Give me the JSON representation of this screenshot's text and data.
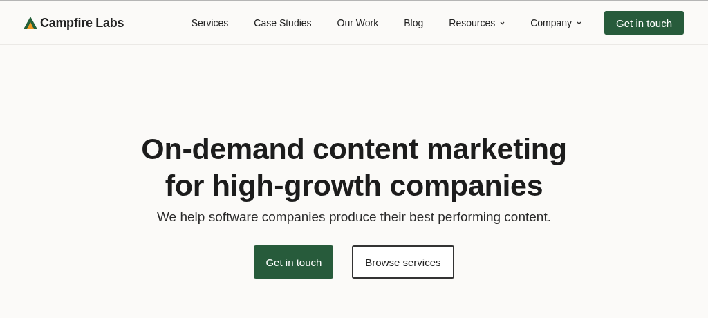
{
  "header": {
    "logo": "Campfire Labs",
    "nav": [
      {
        "label": "Services",
        "kind": "link"
      },
      {
        "label": "Case Studies",
        "kind": "link"
      },
      {
        "label": "Our Work",
        "kind": "link"
      },
      {
        "label": "Blog",
        "kind": "link"
      },
      {
        "label": "Resources",
        "kind": "dropdown"
      },
      {
        "label": "Company",
        "kind": "dropdown"
      }
    ],
    "cta": "Get in touch"
  },
  "hero": {
    "title_lines": [
      "On-demand content marketing",
      "for high-growth companies"
    ],
    "subtitle": "We help software companies produce their best performing content.",
    "buttons": [
      {
        "label": "Get in touch",
        "kind": "primary"
      },
      {
        "label": "Browse services",
        "kind": "secondary"
      }
    ]
  }
}
